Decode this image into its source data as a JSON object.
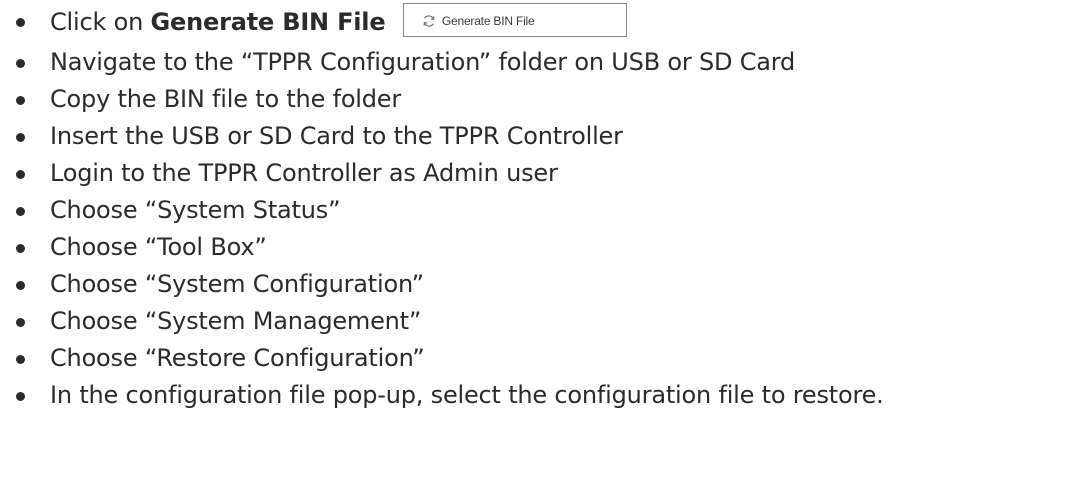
{
  "steps": [
    {
      "prefix": "Click on ",
      "bold": "Generate BIN File",
      "button_label": "Generate BIN File",
      "button_icon": "refresh-icon"
    },
    {
      "text": "Navigate to the “TPPR Configuration” folder on USB or SD Card"
    },
    {
      "text": "Copy the BIN file to the folder"
    },
    {
      "text": "Insert the USB or SD Card to the TPPR Controller"
    },
    {
      "text": "Login to the TPPR Controller as Admin user"
    },
    {
      "text": "Choose “System Status”"
    },
    {
      "text": "Choose “Tool Box”"
    },
    {
      "text": "Choose “System Configuration”"
    },
    {
      "text": "Choose “System Management”"
    },
    {
      "text": "Choose “Restore Configuration”"
    },
    {
      "text": "In the configuration file pop-up, select the configuration file to restore."
    }
  ]
}
